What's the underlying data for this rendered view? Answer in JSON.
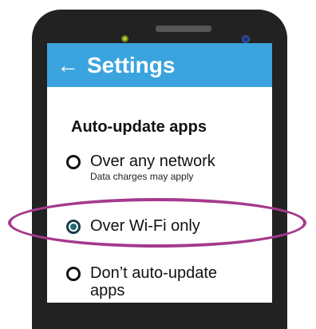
{
  "appbar": {
    "back_icon": "←",
    "title": "Settings"
  },
  "section": {
    "title": "Auto-update apps"
  },
  "options": [
    {
      "label": "Over any network",
      "sublabel": "Data charges may apply",
      "selected": false
    },
    {
      "label": "Over Wi-Fi only",
      "sublabel": "",
      "selected": true
    },
    {
      "label": "Don’t auto-update apps",
      "sublabel": "",
      "selected": false
    }
  ],
  "colors": {
    "appbar": "#3ba4de",
    "highlight_ellipse": "#a53a8e",
    "phone_body": "#222222",
    "selected_radio": "#1f6b73"
  },
  "icons": {
    "back": "arrow-left-icon",
    "radio_unselected": "radio-unselected-icon",
    "radio_selected": "radio-selected-icon"
  }
}
